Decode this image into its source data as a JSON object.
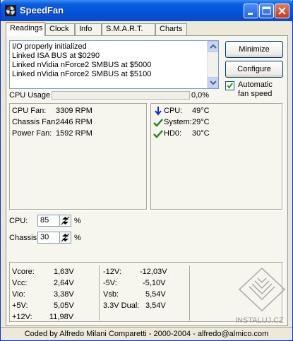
{
  "window": {
    "title": "SpeedFan"
  },
  "tabs": [
    {
      "label": "Readings"
    },
    {
      "label": "Clock"
    },
    {
      "label": "Info"
    },
    {
      "label": "S.M.A.R.T."
    },
    {
      "label": "Charts"
    }
  ],
  "log": {
    "lines": [
      "I/O properly initialized",
      "Linked ISA BUS at $0290",
      "Linked nVidia nForce2 SMBUS at $5000",
      "Linked nVidia nForce2 SMBUS at $5100"
    ]
  },
  "buttons": {
    "minimize": "Minimize",
    "configure": "Configure"
  },
  "auto_fan": {
    "label_line1": "Automatic",
    "label_line2": "fan speed",
    "checked": true
  },
  "cpu_usage": {
    "label": "CPU Usage",
    "value_text": "0,0%",
    "value": 0
  },
  "fans": [
    {
      "name": "CPU Fan:",
      "value": "3309 RPM"
    },
    {
      "name": "Chassis Fan:",
      "value": "2446 RPM"
    },
    {
      "name": "Power Fan:",
      "value": "1592 RPM"
    }
  ],
  "temps": [
    {
      "name": "CPU:",
      "value": "49°C",
      "icon": "arrow-down-icon",
      "color": "#1030d8"
    },
    {
      "name": "System:",
      "value": "29°C",
      "icon": "checkmark-icon",
      "color": "#1a8a1a"
    },
    {
      "name": "HD0:",
      "value": "30°C",
      "icon": "checkmark-icon",
      "color": "#1a8a1a"
    }
  ],
  "speeds": [
    {
      "label": "CPU:",
      "value": "85",
      "unit": "%"
    },
    {
      "label": "Chassis:",
      "value": "30",
      "unit": "%"
    }
  ],
  "voltages_left": [
    {
      "name": "Vcore:",
      "value": "1,63V"
    },
    {
      "name": "Vcc:",
      "value": "2,64V"
    },
    {
      "name": "Vio:",
      "value": "3,38V"
    },
    {
      "name": "+5V:",
      "value": "5,05V"
    },
    {
      "name": "+12V:",
      "value": "11,98V"
    }
  ],
  "voltages_right": [
    {
      "name": "-12V:",
      "value": "-12,03V"
    },
    {
      "name": "-5V:",
      "value": "-5,10V"
    },
    {
      "name": "Vsb:",
      "value": "5,54V"
    },
    {
      "name": "3.3V Dual:",
      "value": "3,54V"
    }
  ],
  "watermark": {
    "text": "INSTALUJ.CZ"
  },
  "status": "Coded by Alfredo Milani Comparetti - 2000-2004 - alfredo@almico.com"
}
